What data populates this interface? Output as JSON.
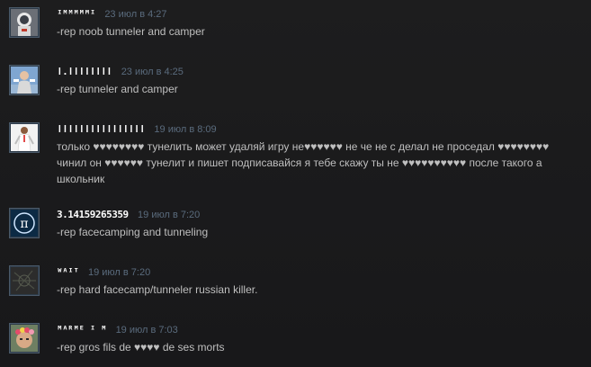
{
  "comments": [
    {
      "author": "ᴵᴹᴹᴹᴹᴹᴵ",
      "time": "23 июл в 4:27",
      "text": "-rep noob tunneler and camper",
      "avatar": "astronaut-avatar"
    },
    {
      "author": "ǀ.ǀǀǀǀǀǀǀǀ",
      "time": "23 июл в 4:25",
      "text": "-rep tunneler and camper",
      "avatar": "person-sky-avatar"
    },
    {
      "author": "ǀǀǀǀǀǀǀǀǀǀǀǀǀǀǀǀ",
      "time": "19 июл в 8:09",
      "text": "только ♥♥♥♥♥♥♥♥ тунелить может удаляй игру не♥♥♥♥♥♥ не че не с делал не проседал ♥♥♥♥♥♥♥♥ чинил он ♥♥♥♥♥♥ тунелит и пишет подписавайся я тебе скажу ты не ♥♥♥♥♥♥♥♥♥♥ после такого а школьник",
      "avatar": "white-suit-avatar"
    },
    {
      "author": "3.14159265359",
      "time": "19 июл в 7:20",
      "text": "-rep facecamping and tunneling",
      "avatar": "pi-avatar"
    },
    {
      "author": "ᵂᴬᴵᵀ",
      "time": "19 июл в 7:20",
      "text": "-rep hard facecamp/tunneler russian killer.",
      "avatar": "dark-pattern-avatar"
    },
    {
      "author": "ᴹᴬᴿᴹᴱ ᴵ ᴹ",
      "time": "19 июл в 7:03",
      "text": "-rep gros fils de ♥♥♥♥ de ses morts",
      "avatar": "flower-crown-avatar"
    }
  ]
}
